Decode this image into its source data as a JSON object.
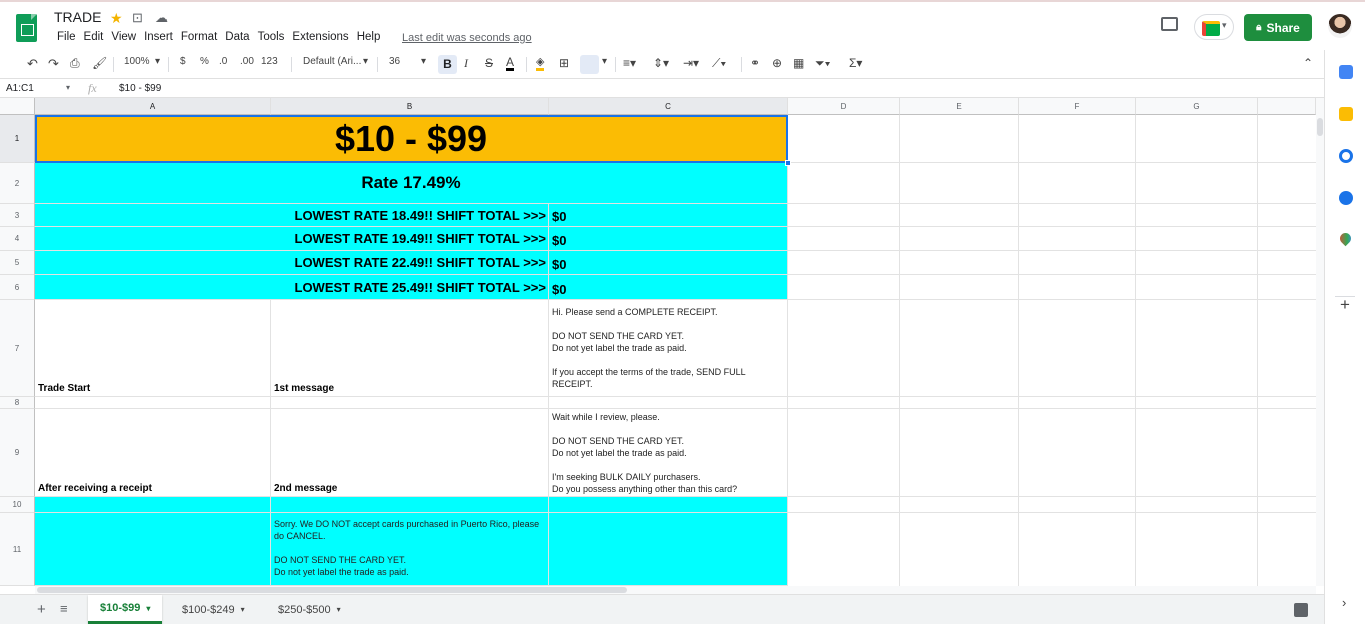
{
  "app": {
    "doc_title": "TRADE",
    "menu": [
      "File",
      "Edit",
      "View",
      "Insert",
      "Format",
      "Data",
      "Tools",
      "Extensions",
      "Help"
    ],
    "last_edit": "Last edit was seconds ago",
    "share_label": "Share"
  },
  "toolbar": {
    "zoom": "100%",
    "currency": "$",
    "percent": "%",
    "dec_decrease": ".0",
    "dec_increase": ".00",
    "format_more": "123",
    "font": "Default (Ari...",
    "font_size": "36",
    "bold": "B",
    "italic": "I",
    "strike": "S",
    "text_color": "A"
  },
  "formula_bar": {
    "name_box": "A1:C1",
    "fx": "fx",
    "value": "$10 - $99"
  },
  "columns": [
    "A",
    "B",
    "C",
    "D",
    "E",
    "F",
    "G"
  ],
  "rows": [
    "1",
    "2",
    "3",
    "4",
    "5",
    "6",
    "7",
    "8",
    "9",
    "10",
    "11"
  ],
  "cells": {
    "title": "$10 - $99",
    "rate": "Rate 17.49%",
    "shift_rows": [
      {
        "label": "LOWEST RATE 18.49!!    SHIFT TOTAL >>>",
        "total": "$0"
      },
      {
        "label": "LOWEST RATE 19.49!!    SHIFT TOTAL >>>",
        "total": "$0"
      },
      {
        "label": "LOWEST RATE 22.49!!    SHIFT TOTAL >>>",
        "total": "$0"
      },
      {
        "label": "LOWEST RATE 25.49!!    SHIFT TOTAL >>>",
        "total": "$0"
      }
    ],
    "row7": {
      "a": "Trade Start",
      "b": "1st message",
      "c": "Hi. Please send a COMPLETE RECEIPT.\n\nDO NOT SEND THE CARD YET.\nDo not yet label the trade as paid.\n\nIf you accept the terms of the trade, SEND FULL RECEIPT."
    },
    "row9": {
      "a": "After receiving a receipt",
      "b": "2nd message",
      "c": "Wait while I review, please.\n\nDO NOT SEND THE CARD YET.\nDo not yet label the trade as paid.\n\nI'm seeking BULK DAILY purchasers.\nDo you possess anything other than this card?"
    },
    "row11": {
      "b": "Sorry. We DO NOT accept cards purchased in Puerto Rico, please do CANCEL.\n\nDO NOT SEND THE CARD YET.\nDo not yet label the trade as paid."
    }
  },
  "sheets": [
    "$10-$99",
    "$100-$249",
    "$250-$500"
  ],
  "colors": {
    "header_fill": "#fbbc04",
    "cyan_fill": "#00ffff",
    "share": "#1e8e3e",
    "active_tab": "#188038"
  }
}
